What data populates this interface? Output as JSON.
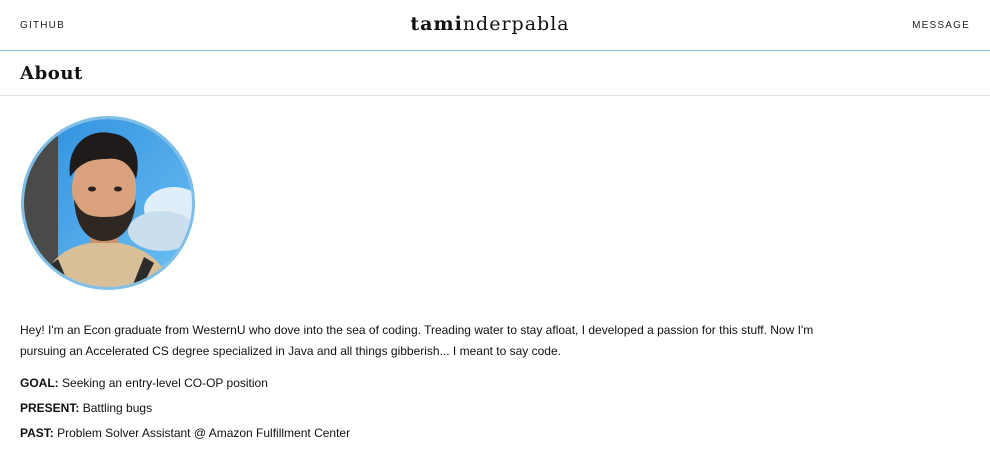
{
  "header": {
    "github_label": "GITHUB",
    "message_label": "MESSAGE",
    "brand_part1": "tami",
    "brand_part2": "nder",
    "brand_part3": "pabla"
  },
  "section": {
    "title": "About"
  },
  "bio": {
    "text": "Hey! I'm an Econ graduate from WesternU who dove into the sea of coding. Treading water to stay afloat, I developed a passion for this stuff. Now I'm pursuing an Accelerated CS degree specialized in Java and all things gibberish... I meant to say code."
  },
  "facts": {
    "goal_label": "GOAL:",
    "goal_value": "Seeking an entry-level CO-OP position",
    "present_label": "PRESENT:",
    "present_value": "Battling bugs",
    "past_label": "PAST:",
    "past_value": "Problem Solver Assistant @ Amazon Fulfillment Center"
  },
  "colors": {
    "header_border": "#7fc1d6",
    "avatar_border": "#7fbfe6",
    "divider": "#e2e2e2"
  }
}
